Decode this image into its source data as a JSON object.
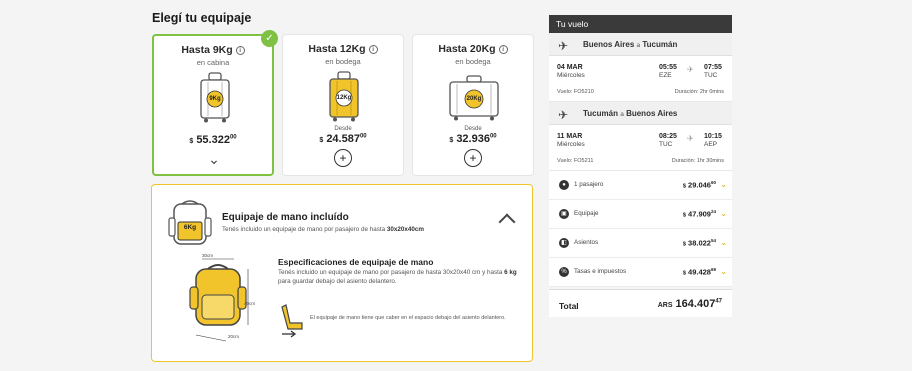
{
  "page_title": "Elegí tu equipaje",
  "options": [
    {
      "title": "Hasta 9Kg",
      "subtitle": "en cabina",
      "kg": "9Kg",
      "desde": "",
      "currency": "$",
      "price": "55.322",
      "cents": "00",
      "selected": true
    },
    {
      "title": "Hasta 12Kg",
      "subtitle": "en bodega",
      "kg": "12Kg",
      "desde": "Desde",
      "currency": "$",
      "price": "24.587",
      "cents": "00",
      "selected": false
    },
    {
      "title": "Hasta 20Kg",
      "subtitle": "en bodega",
      "kg": "20Kg",
      "desde": "Desde",
      "currency": "$",
      "price": "32.936",
      "cents": "00",
      "selected": false
    }
  ],
  "hand": {
    "title": "Equipaje de mano incluído",
    "desc_pre": "Tenés incluido un equipaje de mano por pasajero de hasta ",
    "desc_bold": "30x20x40cm",
    "badge": "6Kg",
    "spec_title": "Especificaciones de equipaje de mano",
    "spec_pre": "Tenés incluido un equipaje de mano por pasajero de hasta 30x20x40 cm y hasta ",
    "spec_bold": "6 kg",
    "spec_post": " para guardar debajo del asiento delantero.",
    "dim_top": "30cm",
    "dim_side": "40cm",
    "dim_bottom": "20cm",
    "seat_note": "El equipaje de mano tiene que caber en el espacio debajo del asiento delantero."
  },
  "summary": {
    "header": "Tu vuelo",
    "flights": [
      {
        "from": "Buenos Aires",
        "sep": "a",
        "to": "Tucumán",
        "date": "04 MAR",
        "day": "Miércoles",
        "dep_time": "05:55",
        "dep_ap": "EZE",
        "arr_time": "07:55",
        "arr_ap": "TUC",
        "flight": "Vuelo: FO5210",
        "duration": "Duración: 2hr 0mins"
      },
      {
        "from": "Tucumán",
        "sep": "a",
        "to": "Buenos Aires",
        "date": "11 MAR",
        "day": "Miércoles",
        "dep_time": "08:25",
        "dep_ap": "TUC",
        "arr_time": "10:15",
        "arr_ap": "AEP",
        "flight": "Vuelo: FO5211",
        "duration": "Duración: 1hr 30mins"
      }
    ],
    "costs": [
      {
        "label": "1 pasajero",
        "icon": "person-icon",
        "currency": "$",
        "value": "29.046",
        "cents": "60"
      },
      {
        "label": "Equipaje",
        "icon": "luggage-icon",
        "currency": "$",
        "value": "47.909",
        "cents": "24"
      },
      {
        "label": "Asientos",
        "icon": "seat-icon",
        "currency": "$",
        "value": "38.022",
        "cents": "54"
      },
      {
        "label": "Tasas e impuestos",
        "icon": "percent-icon",
        "currency": "$",
        "value": "49.428",
        "cents": "69"
      }
    ],
    "total_label": "Total",
    "total_currency": "ARS",
    "total_value": "164.407",
    "total_cents": "47"
  }
}
